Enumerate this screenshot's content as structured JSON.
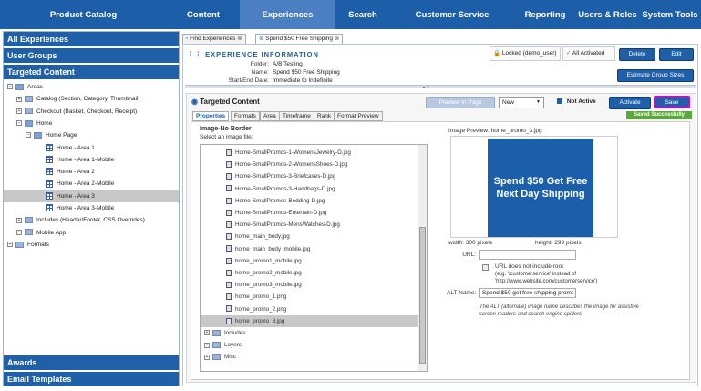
{
  "nav": [
    "Product Catalog",
    "Content",
    "Experiences",
    "Search",
    "Customer Service",
    "Reporting",
    "Users & Roles",
    "System Tools"
  ],
  "nav_active": "Experiences",
  "sidebar": {
    "sections": [
      "All Experiences",
      "User Groups",
      "Targeted Content"
    ],
    "bottom_sections": [
      "Awards",
      "Email Templates"
    ],
    "tree": [
      {
        "label": "Areas",
        "exp": "−",
        "icon": "folder-open"
      },
      {
        "label": "Catalog (Section, Category, Thumbnail)",
        "exp": "+",
        "icon": "folder"
      },
      {
        "label": "Checkout (Basket, Checkout, Receipt)",
        "exp": "+",
        "icon": "folder"
      },
      {
        "label": "Home",
        "exp": "−",
        "icon": "folder-open"
      },
      {
        "label": "Home Page",
        "exp": "−",
        "icon": "folder-open"
      },
      {
        "label": "Home - Area 1",
        "icon": "grid"
      },
      {
        "label": "Home - Area 1-Mobile",
        "icon": "grid"
      },
      {
        "label": "Home - Area 2",
        "icon": "grid"
      },
      {
        "label": "Home - Area 2-Mobile",
        "icon": "grid"
      },
      {
        "label": "Home - Area 3",
        "icon": "grid",
        "selected": true
      },
      {
        "label": "Home - Area 3-Mobile",
        "icon": "grid"
      },
      {
        "label": "Includes (Header/Footer, CSS Overrides)",
        "exp": "+",
        "icon": "folder"
      },
      {
        "label": "Mobile App",
        "exp": "+",
        "icon": "folder"
      },
      {
        "label": "Formats",
        "exp": "+",
        "icon": "folder"
      }
    ]
  },
  "tabs": [
    "Find Experiences",
    "Spend $50 Free Shipping"
  ],
  "info": {
    "title": "EXPERIENCE INFORMATION",
    "folder_label": "Folder:",
    "folder": "A/B Testing",
    "name_label": "Name:",
    "name": "Spend $50 Free Shipping",
    "dates_label": "Start/End Date:",
    "dates": "Immediate to Indefinite",
    "locked": "Locked (demo_user)",
    "activated": "All Activated",
    "delete": "Delete",
    "edit": "Edit",
    "estimate": "Estimate Group Sizes"
  },
  "tc": {
    "title": "Targeted Content",
    "preview": "Preview in Page",
    "status_select": "New",
    "not_active": "Not Active",
    "activate": "Activate",
    "save": "Save",
    "saved": "Saved Successfully",
    "subtabs": [
      "Properties",
      "Formats",
      "Area",
      "Timeframe",
      "Rank",
      "Format Preview"
    ],
    "image_heading": "Image-No Border",
    "select_label": "Select an image file:",
    "files": [
      "Home-SmallPromos-1-WomensJewelry-D.jpg",
      "Home-SmallPromos-2-WomensShoes-D.jpg",
      "Home-SmallPromos-3-Briefcases-D.jpg",
      "Home-SmallPromos-3-Handbags-D.jpg",
      "Home-SmallPromos-Bedding-D.jpg",
      "Home-SmallPromos-Entertain-D.jpg",
      "Home-SmallPromos-MensWatches-D.jpg",
      "home_main_body.jpg",
      "home_main_body_mobile.jpg",
      "home_promo1_mobile.jpg",
      "home_promo2_mobile.jpg",
      "home_promo3_mobile.jpg",
      "home_promo_1.png",
      "home_promo_2.png",
      "home_promo_3.jpg"
    ],
    "selected_file": "home_promo_3.jpg",
    "folders": [
      "Includes",
      "Layers",
      "Misc"
    ],
    "preview_label": "Image Preview: home_promo_3.jpg",
    "preview_text": "Spend $50 Get Free Next Day Shipping",
    "width": "width: 300 pixels",
    "height": "height: 299 pixels",
    "url_label": "URL:",
    "url_value": "",
    "root_label": "URL does not include root",
    "root_note": "(e.g. '/customerservice' instead of 'http://www.website.com/customerservice')",
    "alt_label": "ALT Name:",
    "alt_value": "Spend $50 get free shipping promo",
    "alt_note": "The ALT (alternate) image name describes the image for assistive screen readers and search engine spiders."
  },
  "colors": {
    "nav": "#1c5ea8",
    "accent": "#1f5fa8",
    "save_border": "#d400d4",
    "saved": "#5aa83a",
    "preview_bg": "#1b5faa"
  }
}
